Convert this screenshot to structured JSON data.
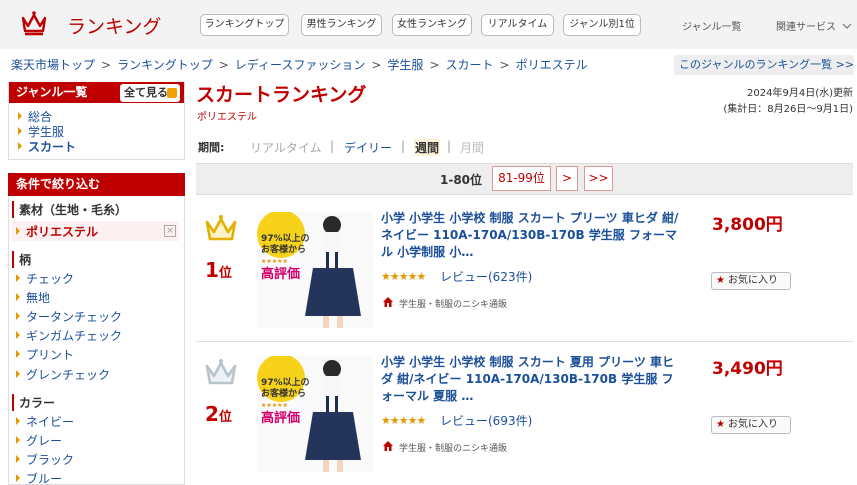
{
  "header": {
    "logo_text": "ランキング",
    "tabs": [
      "ランキングトップ",
      "男性ランキング",
      "女性ランキング",
      "リアルタイム",
      "ジャンル別1位"
    ],
    "genre_list_link": "ジャンル一覧",
    "related_services": "関連サービス"
  },
  "breadcrumb": [
    "楽天市場トップ",
    "ランキングトップ",
    "レディースファッション",
    "学生服",
    "スカート",
    "ポリエステル"
  ],
  "breadcrumb_sep": ">",
  "genre_ranking_list_link": "このジャンルのランキング一覧 >>",
  "sidebar": {
    "genre_heading": "ジャンル一覧",
    "see_all": "全て見る",
    "genres": [
      "総合",
      "学生服",
      "スカート"
    ],
    "filter_heading": "条件で絞り込む",
    "material_heading": "素材（生地・毛糸）",
    "selected_material": "ポリエステル",
    "remove_icon": "×",
    "pattern_heading": "柄",
    "patterns": [
      "チェック",
      "無地",
      "タータンチェック",
      "ギンガムチェック",
      "プリント",
      "グレンチェック"
    ],
    "color_heading": "カラー",
    "colors": [
      "ネイビー",
      "グレー",
      "ブラック",
      "ブルー"
    ]
  },
  "main": {
    "title": "スカートランキング",
    "subtitle": "ポリエステル",
    "updated": "2024年9月4日(水)更新",
    "aggregate": "(集計日：8月26日〜9月1日)",
    "period_label": "期間:",
    "period_options": [
      "リアルタイム",
      "デイリー",
      "週間",
      "月間"
    ],
    "period_sep": "|",
    "pager_current": "1-80位",
    "pager_next_range": "81-99位",
    "pager_next": ">",
    "pager_last": ">>"
  },
  "items": [
    {
      "rank": "1",
      "rank_suffix": "位",
      "title": "小学 小学生 小学校 制服 スカート プリーツ 車ヒダ 紺/ネイビー 110A-170A/130B-170B 学生服 フォーマル 小学制服 小…",
      "stars": "★★★★★",
      "review": "レビュー(623件)",
      "shop": "学生服・制服のニシキ通販",
      "price": "3,800円",
      "fav": "お気に入り",
      "thumb_badge": "97%以上の",
      "thumb_badge2": "お客様から",
      "thumb_badge3": "高評価",
      "thumb_badge_stars": "★★★★★"
    },
    {
      "rank": "2",
      "rank_suffix": "位",
      "title": "小学 小学生 小学校 制服 スカート 夏用 プリーツ 車ヒダ 紺/ネイビー 110A-170A/130B-170B 学生服 フォーマル 夏服 …",
      "stars": "★★★★★",
      "review": "レビュー(693件)",
      "shop": "学生服・制服のニシキ通販",
      "price": "3,490円",
      "fav": "お気に入り",
      "thumb_badge": "97%以上の",
      "thumb_badge2": "お客様から",
      "thumb_badge3": "高評価",
      "thumb_badge_stars": "★★★★★"
    }
  ],
  "colors": {
    "brand_red": "#bf0000",
    "link_blue": "#1a4f99",
    "gold": "#e39a00",
    "silver": "#b8c4cc"
  },
  "icons": {
    "logo": "crown-icon",
    "gold_crown": "gold-crown-icon",
    "silver_crown": "silver-crown-icon",
    "shop": "shop-icon",
    "favorite": "star-icon"
  }
}
